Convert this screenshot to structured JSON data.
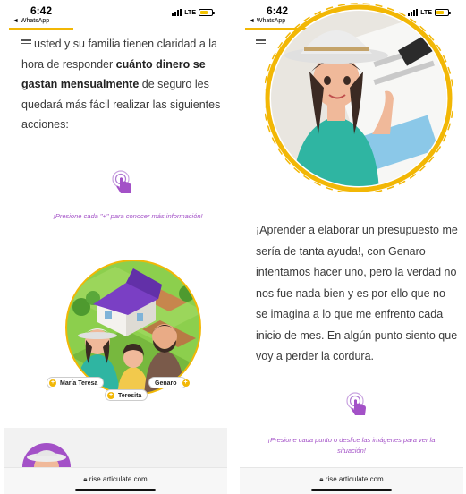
{
  "status": {
    "time": "6:42",
    "back_app": "◄ WhatsApp",
    "network": "LTE",
    "battery_level": 0.7
  },
  "left": {
    "paragraph": {
      "t1": "usted y su familia tienen claridad a la hora de responder ",
      "bold": "cuánto dinero se gastan mensualmente",
      "t2": " de seguro les quedará más fácil realizar las siguientes acciones:"
    },
    "hint": "¡Presione cada \"+\" para conocer más información!",
    "names": [
      "María Teresa",
      "Teresita",
      "Genaro"
    ]
  },
  "right": {
    "paragraph": "¡Aprender a elaborar un presupuesto me sería de tanta ayuda!, con Genaro intentamos hacer uno, pero la verdad no nos fue nada bien y es por ello que no se imagina a lo que me enfrento cada inicio de mes. En algún punto siento que voy a perder la cordura.",
    "hint": "¡Presione cada punto o deslice las imágenes para ver la situación!"
  },
  "url": "rise.articulate.com",
  "colors": {
    "accent": "#f2b705",
    "hint": "#a351c7",
    "house_roof": "#7a3fc4",
    "grass": "#7cc043"
  }
}
